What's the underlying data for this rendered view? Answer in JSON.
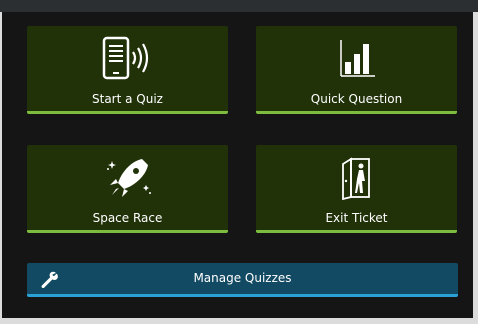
{
  "tiles": {
    "start_quiz": {
      "label": "Start a Quiz",
      "icon": "tablet-wireless-icon"
    },
    "quick_question": {
      "label": "Quick Question",
      "icon": "bar-chart-icon"
    },
    "space_race": {
      "label": "Space Race",
      "icon": "rocket-icon"
    },
    "exit_ticket": {
      "label": "Exit Ticket",
      "icon": "exit-door-icon"
    }
  },
  "manage": {
    "label": "Manage Quizzes",
    "icon": "wrench-icon"
  },
  "colors": {
    "tile_bg": "#213108",
    "tile_accent": "#7cbd3f",
    "manage_bg": "#134a63",
    "manage_accent": "#2aa2d6",
    "panel_bg": "#151515"
  }
}
